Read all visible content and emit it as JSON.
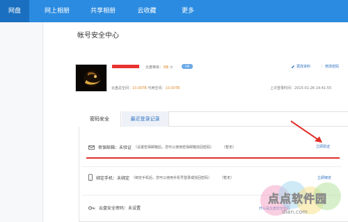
{
  "nav": {
    "tabs": [
      {
        "label": "网盘"
      },
      {
        "label": "网上相册"
      },
      {
        "label": "共享相册"
      },
      {
        "label": "云收藏"
      },
      {
        "label": "更多"
      }
    ]
  },
  "page": {
    "title": "帐号安全中心"
  },
  "profile": {
    "level_label": "云盘等级：",
    "level_value": "3级",
    "vip_badge": "VIP",
    "edit_profile": "更改资料",
    "separator": "|",
    "change_password": "修改密码",
    "total_space_label": "云盘总空间：",
    "total_space_value": "10.00TB",
    "available_space_label": "可用空间：",
    "available_space_value": "10.00TB",
    "last_login_label": "上次登录时间：",
    "last_login_value": "2015-01-26 14:41:55"
  },
  "security_tabs": [
    {
      "label": "密码安全"
    },
    {
      "label": "最近登录记录"
    }
  ],
  "security_items": [
    {
      "label": "密保邮箱：",
      "value": "未验证",
      "hint": "（设置密保邮箱后，您可以使用密保邮箱找回密码）",
      "status": "（暂无）",
      "action": "立即验证",
      "icon": "mail-icon"
    },
    {
      "label": "绑定手机：",
      "value": "未绑定",
      "hint": "（绑定手机后，您可以使用手机号登录或找回密码）",
      "status": "（暂无）",
      "action": "立即绑定",
      "icon": "phone-icon"
    },
    {
      "label": "云盘安全密码：",
      "value": "未设置",
      "hint": "",
      "status": "",
      "action": "什么是云盘安全密码",
      "icon": "key-icon"
    }
  ],
  "watermark": {
    "text": "点点软件园",
    "url": "dian.com"
  },
  "colors": {
    "nav": "#2b8be0",
    "nav_active": "#1a6fc0",
    "link": "#2b6fc0",
    "accent": "#e08a2a",
    "annotation": "#e23028"
  }
}
